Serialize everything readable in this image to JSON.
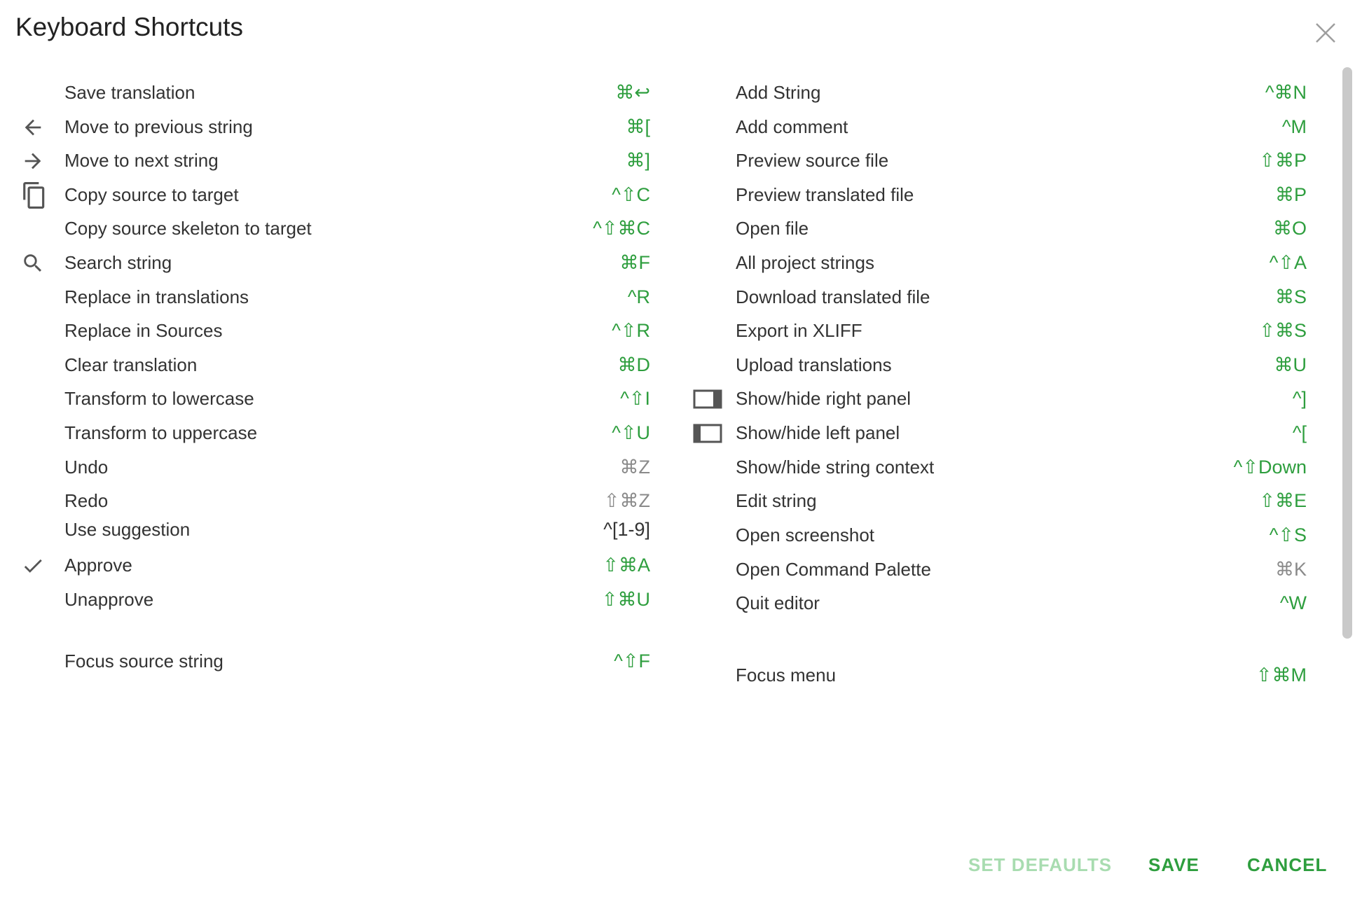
{
  "dialog": {
    "title": "Keyboard Shortcuts",
    "close_icon": "close-icon"
  },
  "colors": {
    "accent": "#2e9e3e",
    "accent_disabled": "#a8dcb0",
    "muted": "#8a8a8a",
    "text": "#333333"
  },
  "left_shortcuts": [
    {
      "label": "Save translation",
      "keys": "⌘↩",
      "icon": ""
    },
    {
      "label": "Move to previous string",
      "keys": "⌘[",
      "icon": "arrow-left-icon"
    },
    {
      "label": "Move to next string",
      "keys": "⌘]",
      "icon": "arrow-right-icon"
    },
    {
      "label": "Copy source to target",
      "keys": "^⇧C",
      "icon": "copy-icon"
    },
    {
      "label": "Copy source skeleton to target",
      "keys": "^⇧⌘C",
      "icon": ""
    },
    {
      "label": "Search string",
      "keys": "⌘F",
      "icon": "search-icon"
    },
    {
      "label": "Replace in translations",
      "keys": "^R",
      "icon": ""
    },
    {
      "label": "Replace in Sources",
      "keys": "^⇧R",
      "icon": ""
    },
    {
      "label": "Clear translation",
      "keys": "⌘D",
      "icon": ""
    },
    {
      "label": "Transform to lowercase",
      "keys": "^⇧I",
      "icon": ""
    },
    {
      "label": "Transform to uppercase",
      "keys": "^⇧U",
      "icon": ""
    },
    {
      "label": "Undo",
      "keys": "⌘Z",
      "icon": "",
      "style": "muted"
    },
    {
      "label": "Redo",
      "keys": "⇧⌘Z",
      "icon": "",
      "style": "muted"
    },
    {
      "label": "Use suggestion",
      "keys": "^[1-9]",
      "icon": "",
      "style": "dark"
    },
    {
      "label": "Approve",
      "keys": "⇧⌘A",
      "icon": "check-icon"
    },
    {
      "label": "Unapprove",
      "keys": "⇧⌘U",
      "icon": ""
    },
    {
      "label": "Focus source string",
      "keys": "^⇧F",
      "icon": ""
    }
  ],
  "right_shortcuts": [
    {
      "label": "Add String",
      "keys": "^⌘N",
      "icon": ""
    },
    {
      "label": "Add comment",
      "keys": "^M",
      "icon": ""
    },
    {
      "label": "Preview source file",
      "keys": "⇧⌘P",
      "icon": ""
    },
    {
      "label": "Preview translated file",
      "keys": "⌘P",
      "icon": ""
    },
    {
      "label": "Open file",
      "keys": "⌘O",
      "icon": ""
    },
    {
      "label": "All project strings",
      "keys": "^⇧A",
      "icon": ""
    },
    {
      "label": "Download translated file",
      "keys": "⌘S",
      "icon": ""
    },
    {
      "label": "Export in XLIFF",
      "keys": "⇧⌘S",
      "icon": ""
    },
    {
      "label": "Upload translations",
      "keys": "⌘U",
      "icon": ""
    },
    {
      "label": "Show/hide right panel",
      "keys": "^]",
      "icon": "right-panel-icon"
    },
    {
      "label": "Show/hide left panel",
      "keys": "^[",
      "icon": "left-panel-icon"
    },
    {
      "label": "Show/hide string context",
      "keys": "^⇧Down",
      "icon": ""
    },
    {
      "label": "Edit string",
      "keys": "⇧⌘E",
      "icon": ""
    },
    {
      "label": "Open screenshot",
      "keys": "^⇧S",
      "icon": ""
    },
    {
      "label": "Open Command Palette",
      "keys": "⌘K",
      "icon": "",
      "style": "muted"
    },
    {
      "label": "Quit editor",
      "keys": "^W",
      "icon": ""
    },
    {
      "label": "Focus menu",
      "keys": "⇧⌘M",
      "icon": ""
    }
  ],
  "footer": {
    "set_defaults": "SET DEFAULTS",
    "save": "SAVE",
    "cancel": "CANCEL"
  }
}
